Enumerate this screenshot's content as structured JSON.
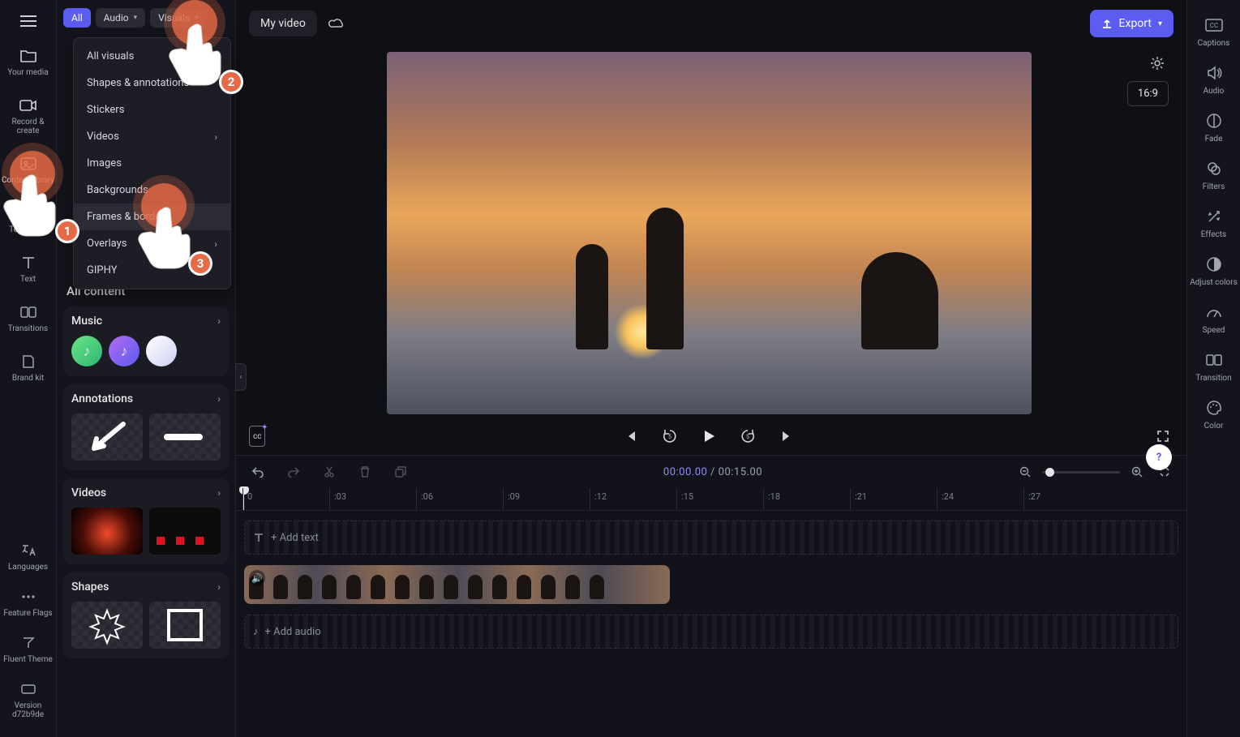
{
  "colors": {
    "accent": "#5b5cf0",
    "tutorial": "#e76a46"
  },
  "left_rail": {
    "items": [
      {
        "id": "your-media",
        "label": "Your media"
      },
      {
        "id": "record-create",
        "label": "Record & create"
      },
      {
        "id": "content-library",
        "label": "Content library"
      },
      {
        "id": "templates",
        "label": "Templates"
      },
      {
        "id": "text",
        "label": "Text"
      },
      {
        "id": "transitions",
        "label": "Transitions"
      },
      {
        "id": "brand-kit",
        "label": "Brand kit"
      }
    ],
    "bottom": [
      {
        "id": "languages",
        "label": "Languages"
      },
      {
        "id": "feature-flags",
        "label": "Feature Flags"
      },
      {
        "id": "fluent-theme",
        "label": "Fluent Theme"
      },
      {
        "id": "version",
        "label": "Version d72b9de"
      }
    ]
  },
  "panel": {
    "tabs": {
      "all": "All",
      "audio": "Audio",
      "visuals": "Visuals"
    },
    "visuals_menu": [
      {
        "label": "All visuals",
        "submenu": false
      },
      {
        "label": "Shapes & annotations",
        "submenu": false
      },
      {
        "label": "Stickers",
        "submenu": false
      },
      {
        "label": "Videos",
        "submenu": true
      },
      {
        "label": "Images",
        "submenu": false
      },
      {
        "label": "Backgrounds",
        "submenu": false
      },
      {
        "label": "Frames & borders",
        "submenu": false,
        "highlight": true
      },
      {
        "label": "Overlays",
        "submenu": true
      },
      {
        "label": "GIPHY",
        "submenu": false
      }
    ],
    "all_heading": "All content",
    "sections": {
      "music": "Music",
      "annotations": "Annotations",
      "videos": "Videos",
      "shapes": "Shapes"
    }
  },
  "header": {
    "title": "My video",
    "export": "Export",
    "aspect": "16:9"
  },
  "playback": {
    "cc_label": "cc",
    "current": "00:00.00",
    "total": "00:15.00",
    "separator": " / "
  },
  "timeline": {
    "ruler": [
      "0",
      ":03",
      ":06",
      ":09",
      ":12",
      ":15",
      ":18",
      ":21",
      ":24",
      ":27"
    ],
    "add_text": "+ Add text",
    "add_audio": "+ Add audio"
  },
  "right_rail": {
    "items": [
      {
        "id": "captions",
        "label": "Captions"
      },
      {
        "id": "audio",
        "label": "Audio"
      },
      {
        "id": "fade",
        "label": "Fade"
      },
      {
        "id": "filters",
        "label": "Filters"
      },
      {
        "id": "effects",
        "label": "Effects"
      },
      {
        "id": "adjust-colors",
        "label": "Adjust colors"
      },
      {
        "id": "speed",
        "label": "Speed"
      },
      {
        "id": "transition",
        "label": "Transition"
      },
      {
        "id": "color",
        "label": "Color"
      }
    ]
  },
  "tutorial": {
    "step1": "1",
    "step2": "2",
    "step3": "3"
  },
  "help": "?"
}
